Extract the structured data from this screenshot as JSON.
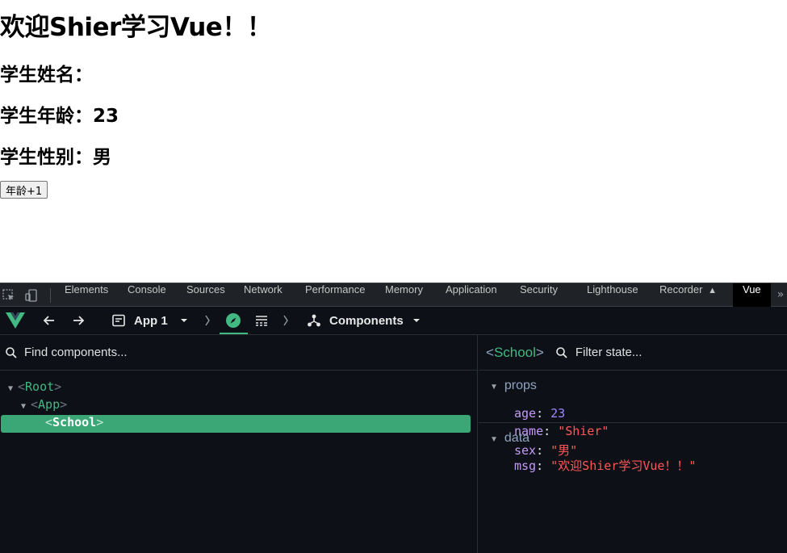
{
  "page": {
    "title": "欢迎Shier学习Vue！！",
    "student_name_label": "学生姓名：",
    "student_age_label": "学生年龄：23",
    "student_sex_label": "学生性别：男",
    "age_button_label": "年龄+1"
  },
  "devtools": {
    "tabs": [
      "Elements",
      "Console",
      "Sources",
      "Network",
      "Performance",
      "Memory",
      "Application",
      "Security",
      "Lighthouse",
      "Recorder",
      "Vue"
    ],
    "active_tab": "Vue",
    "more_glyph": "»",
    "vue_toolbar": {
      "app_selector": "App 1",
      "components_label": "Components"
    },
    "left": {
      "search_placeholder": "Find components...",
      "tree": [
        {
          "open": "<",
          "name": "Root",
          "close": ">"
        },
        {
          "open": "<",
          "name": "App",
          "close": ">"
        },
        {
          "open": "<",
          "name": "School",
          "close": ">",
          "selected": true
        }
      ]
    },
    "right": {
      "component_open": "<",
      "component_name": "School",
      "component_close": ">",
      "filter_placeholder": "Filter state...",
      "props_title": "props",
      "props": [
        {
          "key": "age",
          "value": "23",
          "kind": "number"
        },
        {
          "key": "name",
          "value": "\"Shier\"",
          "kind": "string"
        },
        {
          "key": "sex",
          "value": "\"男\"",
          "kind": "string"
        }
      ],
      "data_title": "data",
      "data": [
        {
          "key": "msg",
          "value": "\"欢迎Shier学习Vue！！\"",
          "kind": "string"
        }
      ]
    }
  },
  "colors": {
    "vue_green": "#42b883",
    "selected_row": "#3ba776",
    "devtools_bg": "#0d1117",
    "key_purple": "#c49af5",
    "number_purple": "#9f86ff",
    "string_red": "#ff5757"
  }
}
